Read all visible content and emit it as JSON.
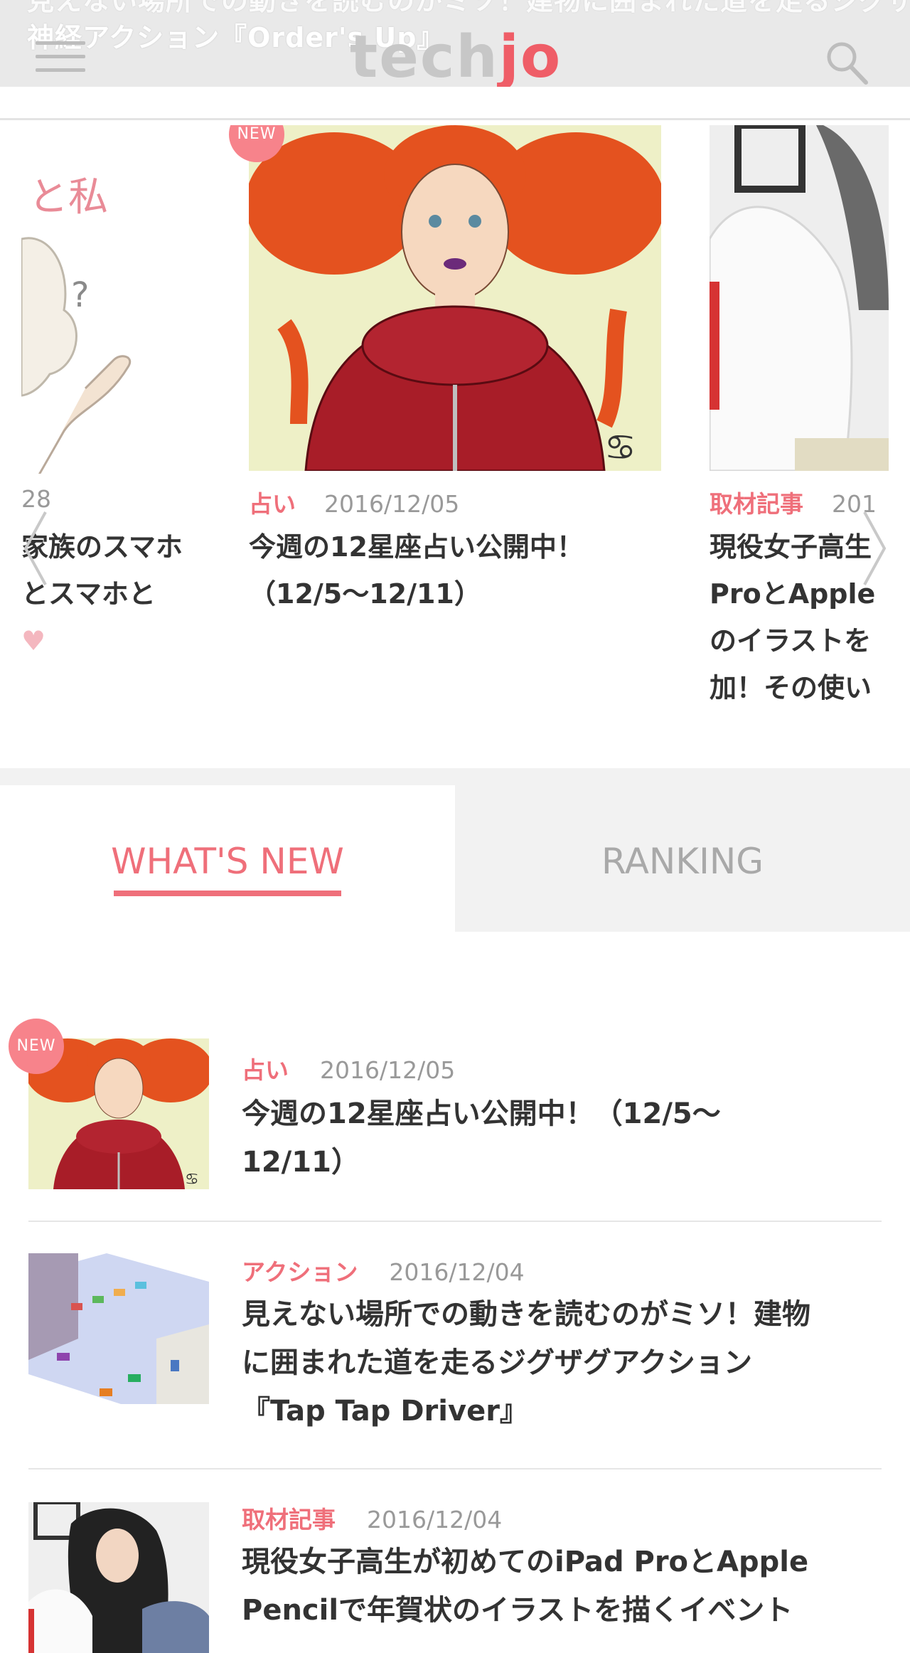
{
  "header": {
    "ticker_line1": "見えない場所での動きを読むのがミソ！建物に囲まれた道を走るジグザグ",
    "ticker_line2": "神経アクション『Order's Up』",
    "logo_tech": "tech",
    "logo_jo": "jo",
    "menu_icon": "hamburger-icon",
    "search_icon": "search-icon"
  },
  "carousel": {
    "left_slide": {
      "date_partial": "28",
      "title_line1": "家族のスマホ",
      "title_line2": "とスマホと",
      "heart": "♥"
    },
    "center_slide": {
      "badge": "NEW",
      "category": "占い",
      "date": "2016/12/05",
      "title_line1": "今週の12星座占い公開中！",
      "title_line2": "（12/5〜12/11）"
    },
    "right_slide": {
      "category": "取材記事",
      "date_partial": "201",
      "title_line1": "現役女子高生",
      "title_line2": "ProとApple",
      "title_line3": "のイラストを",
      "title_line4": "加！その使い"
    }
  },
  "tabs": {
    "whats_new": "WHAT'S NEW",
    "ranking": "RANKING"
  },
  "list": [
    {
      "badge": "NEW",
      "category": "占い",
      "date": "2016/12/05",
      "title_line1": "今週の12星座占い公開中！（12/5〜",
      "title_line2": "12/11）"
    },
    {
      "category": "アクション",
      "date": "2016/12/04",
      "title_line1": "見えない場所での動きを読むのがミソ！建物",
      "title_line2": "に囲まれた道を走るジグザグアクション",
      "title_line3": "『Tap Tap Driver』"
    },
    {
      "category": "取材記事",
      "date": "2016/12/04",
      "title_line1": "現役女子高生が初めてのiPad ProとApple",
      "title_line2": "Pencilで年賀状のイラストを描くイベント"
    }
  ],
  "colors": {
    "accent": "#ef6f7a",
    "badge": "#f7838b",
    "header_bg": "#e9e9e9",
    "tab_inactive_bg": "#f2f2f2"
  }
}
